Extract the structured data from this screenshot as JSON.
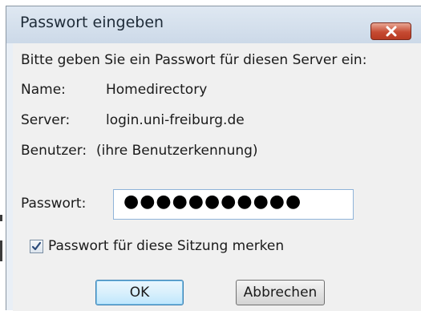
{
  "dialog": {
    "title": "Passwort eingeben",
    "close_icon": "close-icon",
    "prompt": "Bitte geben Sie ein Passwort für diesen Server ein:",
    "fields": {
      "name_label": "Name:",
      "name_value": "Homedirectory",
      "server_label": "Server:",
      "server_value": "login.uni-freiburg.de",
      "user_label": "Benutzer:",
      "user_value": "(ihre Benutzerkennung)"
    },
    "password": {
      "label": "Passwort:",
      "masked_value": "●●●●●●●●●●●"
    },
    "remember": {
      "label": "Passwort für diese Sitzung merken",
      "checked": true
    },
    "buttons": {
      "ok_label": "OK",
      "cancel_label": "Abbrechen"
    }
  },
  "colors": {
    "close_button": "#c64b33",
    "dialog_frame": "#e9eff6",
    "client_background": "#f0f0f0"
  }
}
